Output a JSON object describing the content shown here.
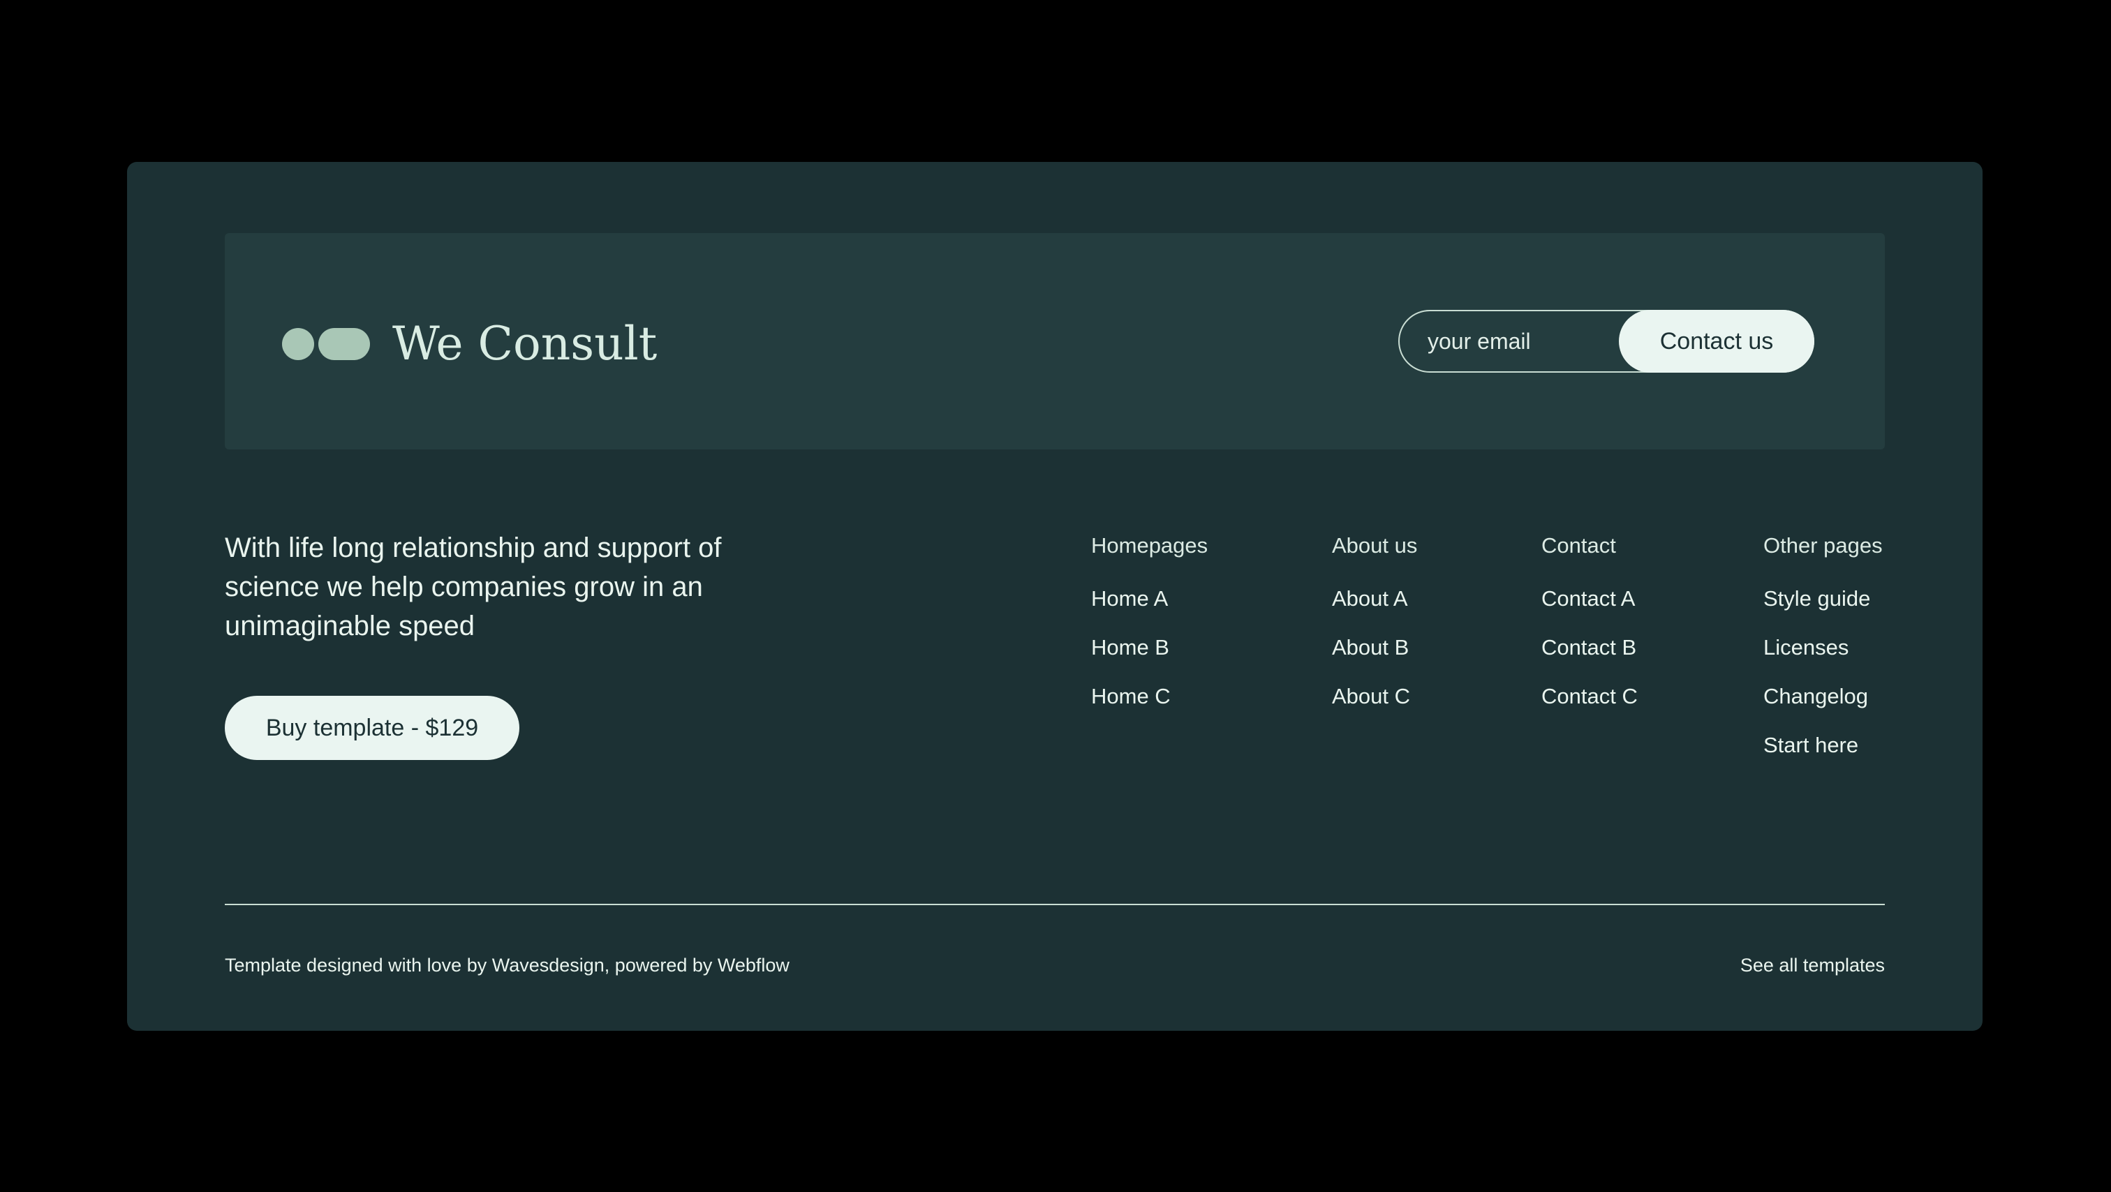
{
  "brand": {
    "name": "We Consult",
    "logo_icon": "two-dot-pill-logo",
    "logo_color": "#a9c7b6"
  },
  "subscribe": {
    "placeholder": "your email",
    "value": "",
    "button_label": "Contact us"
  },
  "tagline": "With life long relationship and support of science we help companies grow in an unimaginable speed",
  "buy_button": "Buy template - $129",
  "nav": [
    {
      "heading": "Homepages",
      "links": [
        "Home A",
        "Home B",
        "Home C"
      ]
    },
    {
      "heading": "About us",
      "links": [
        "About A",
        "About B",
        "About C"
      ]
    },
    {
      "heading": "Contact",
      "links": [
        "Contact A",
        "Contact B",
        "Contact C"
      ]
    },
    {
      "heading": "Other pages",
      "links": [
        "Style guide",
        "Licenses",
        "Changelog",
        "Start here"
      ]
    }
  ],
  "footer": {
    "credits": "Template designed with love by Wavesdesign, powered by Webflow",
    "see_all": "See all templates"
  },
  "colors": {
    "page_background": "#000000",
    "card_background": "#1c3134",
    "panel_background": "#243d3f",
    "button_background": "#eaf5f1",
    "text": "#eaf5ef"
  }
}
